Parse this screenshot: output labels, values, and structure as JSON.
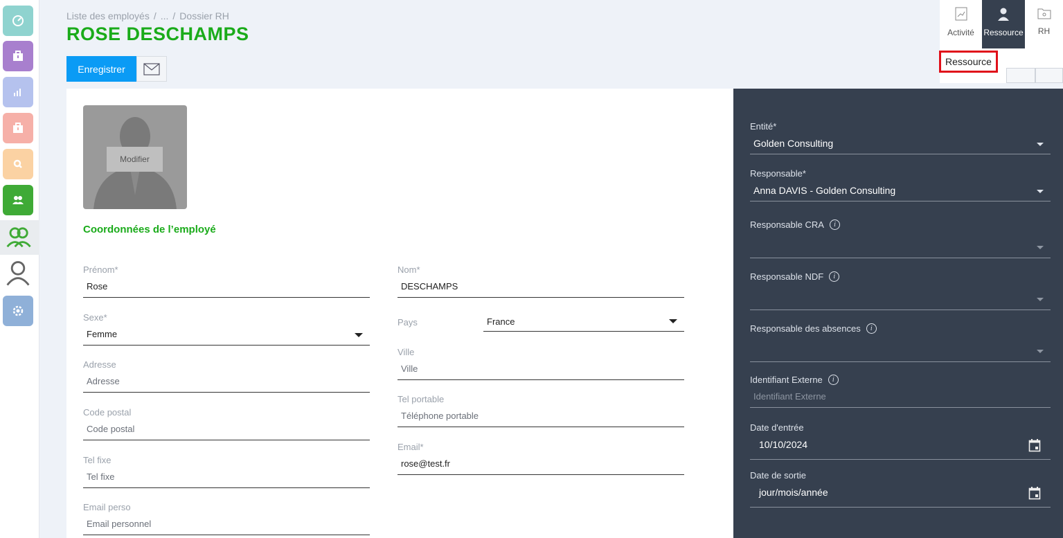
{
  "breadcrumb": {
    "item1": "Liste des employés",
    "sep": "/",
    "item2": "...",
    "item3": "Dossier RH"
  },
  "page_title": "ROSE DESCHAMPS",
  "toolbar": {
    "save_label": "Enregistrer"
  },
  "tabs": [
    {
      "label": "Activité",
      "icon": "chart-file-icon"
    },
    {
      "label": "Ressource",
      "icon": "user-icon"
    },
    {
      "label": "RH",
      "icon": "folder-icon"
    }
  ],
  "tooltip": "Ressource",
  "photo": {
    "modify_label": "Modifier"
  },
  "section_title": "Coordonnées de l’employé",
  "form": {
    "prenom": {
      "label": "Prénom*",
      "value": "Rose"
    },
    "nom": {
      "label": "Nom*",
      "value": "DESCHAMPS"
    },
    "sexe": {
      "label": "Sexe*",
      "value": "Femme"
    },
    "pays": {
      "label": "Pays",
      "value": "France"
    },
    "ville": {
      "label": "Ville",
      "placeholder": "Ville"
    },
    "adresse": {
      "label": "Adresse",
      "placeholder": "Adresse"
    },
    "tel_portable": {
      "label": "Tel portable",
      "placeholder": "Téléphone portable"
    },
    "code_postal": {
      "label": "Code postal",
      "placeholder": "Code postal"
    },
    "email": {
      "label": "Email*",
      "value": "rose@test.fr"
    },
    "tel_fixe": {
      "label": "Tel fixe",
      "placeholder": "Tel fixe"
    },
    "email_perso": {
      "label": "Email perso",
      "placeholder": "Email personnel"
    }
  },
  "right_panel": {
    "entite": {
      "label": "Entité*",
      "value": "Golden Consulting"
    },
    "responsable": {
      "label": "Responsable*",
      "value": "Anna DAVIS - Golden Consulting"
    },
    "responsable_cra": {
      "label": "Responsable CRA",
      "value": ""
    },
    "responsable_ndf": {
      "label": "Responsable NDF",
      "value": ""
    },
    "responsable_absences": {
      "label": "Responsable des absences",
      "value": ""
    },
    "identifiant_externe": {
      "label": "Identifiant Externe",
      "placeholder": "Identifiant Externe"
    },
    "date_entree": {
      "label": "Date d'entrée",
      "value": "10/10/2024"
    },
    "date_sortie": {
      "label": "Date de sortie",
      "value": "jour/mois/année"
    },
    "info_glyph": "i"
  },
  "colors": {
    "accent_green": "#1aab1a",
    "primary_blue": "#0a9bf5",
    "panel_dark": "#36404f",
    "highlight_red": "#e0101a"
  }
}
